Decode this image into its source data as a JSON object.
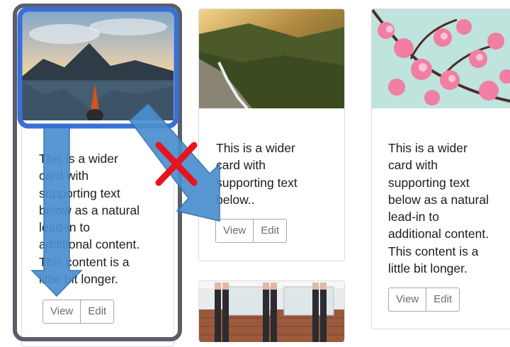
{
  "cards": [
    {
      "image": "lake-mountain-kayak-photo",
      "text_lines": [
        "This is a wider",
        "card with",
        "supporting text",
        "below as a natural",
        "lead-in to",
        "additional content.",
        "This content is a",
        "little bit longer."
      ],
      "view_label": "View",
      "edit_label": "Edit"
    },
    {
      "image": "forest-waterfall-photo",
      "text_lines": [
        "This is a wider",
        "card with",
        "supporting text",
        "below.."
      ],
      "view_label": "View",
      "edit_label": "Edit"
    },
    {
      "image": "cherry-blossom-photo",
      "text_lines": [
        "This is a wider",
        "card with",
        "supporting text",
        "below as a natural",
        "lead-in to",
        "additional content.",
        "This content is a",
        "little bit longer."
      ],
      "view_label": "View",
      "edit_label": "Edit"
    },
    {
      "image": "yoga-legs-photo"
    }
  ],
  "annotations": {
    "selection_color": "#3a6fd8",
    "container_color": "#5a5e66",
    "arrow_color": "#4a8fcf",
    "cross_color": "#e8141c"
  }
}
